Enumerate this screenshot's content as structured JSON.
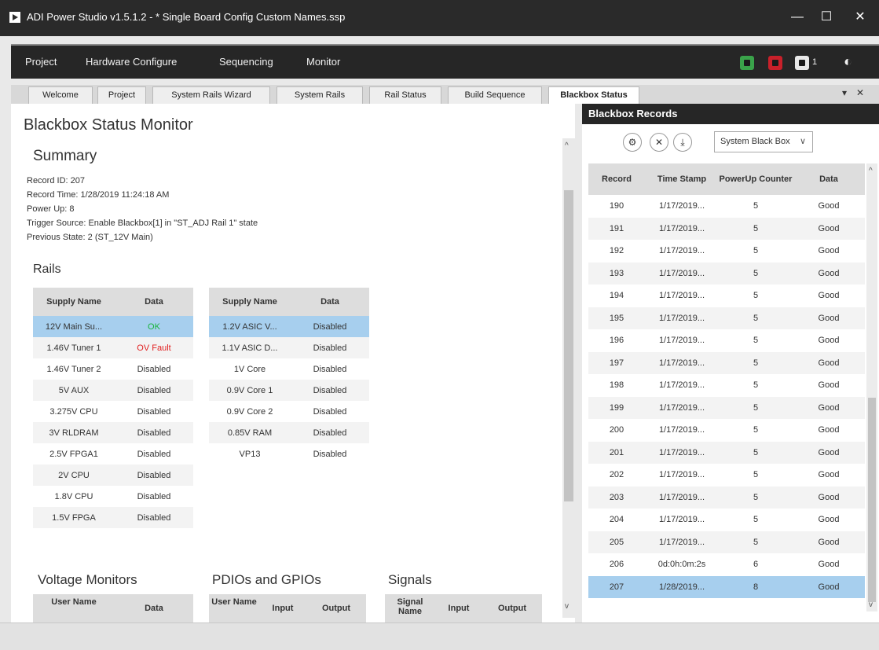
{
  "window": {
    "title": "ADI Power Studio v1.5.1.2 - * Single Board Config Custom Names.ssp",
    "minimize": "—",
    "maximize": "☐",
    "close": "✕"
  },
  "menu": {
    "items": [
      "Project",
      "Hardware Configure",
      "Sequencing",
      "Monitor"
    ],
    "device_count": "1"
  },
  "tabs": {
    "items": [
      "Welcome",
      "Project",
      "System Rails Wizard",
      "System Rails",
      "Rail Status",
      "Build Sequence",
      "Blackbox Status"
    ],
    "active": "Blackbox Status",
    "dropdown": "▾",
    "close": "✕"
  },
  "monitor": {
    "title": "Blackbox Status Monitor",
    "summary_heading": "Summary",
    "record_id": "Record ID: 207",
    "record_time": "Record Time: 1/28/2019 11:24:18 AM",
    "power_up": "Power Up: 8",
    "trigger_source": "Trigger Source: Enable Blackbox[1] in \"ST_ADJ Rail 1\" state",
    "previous_state": "Previous State: 2 (ST_12V Main)",
    "rails_heading": "Rails",
    "col_supply_name": "Supply Name",
    "col_data": "Data",
    "rails_left": [
      {
        "name": "12V Main Su...",
        "data": "OK"
      },
      {
        "name": "1.46V Tuner 1",
        "data": "OV Fault"
      },
      {
        "name": "1.46V Tuner 2",
        "data": "Disabled"
      },
      {
        "name": "5V AUX",
        "data": "Disabled"
      },
      {
        "name": "3.275V CPU",
        "data": "Disabled"
      },
      {
        "name": "3V RLDRAM",
        "data": "Disabled"
      },
      {
        "name": "2.5V FPGA1",
        "data": "Disabled"
      },
      {
        "name": "2V CPU",
        "data": "Disabled"
      },
      {
        "name": "1.8V CPU",
        "data": "Disabled"
      },
      {
        "name": "1.5V FPGA",
        "data": "Disabled"
      }
    ],
    "rails_right": [
      {
        "name": "1.2V ASIC V...",
        "data": "Disabled"
      },
      {
        "name": "1.1V ASIC D...",
        "data": "Disabled"
      },
      {
        "name": "1V Core",
        "data": "Disabled"
      },
      {
        "name": "0.9V Core 1",
        "data": "Disabled"
      },
      {
        "name": "0.9V Core 2",
        "data": "Disabled"
      },
      {
        "name": "0.85V RAM",
        "data": "Disabled"
      },
      {
        "name": "VP13",
        "data": "Disabled"
      }
    ],
    "voltage_monitors_heading": "Voltage Monitors",
    "pdios_heading": "PDIOs and GPIOs",
    "signals_heading": "Signals",
    "col_user_name": "User Name",
    "col_input": "Input",
    "col_output": "Output",
    "col_signal_name": "Signal Name"
  },
  "records": {
    "header": "Blackbox Records",
    "selector_value": "System Black Box",
    "col_record": "Record",
    "col_time_stamp": "Time Stamp",
    "col_powerup_counter": "PowerUp Counter",
    "col_data": "Data",
    "rows": [
      {
        "record": "190",
        "time": "1/17/2019...",
        "counter": "5",
        "data": "Good"
      },
      {
        "record": "191",
        "time": "1/17/2019...",
        "counter": "5",
        "data": "Good"
      },
      {
        "record": "192",
        "time": "1/17/2019...",
        "counter": "5",
        "data": "Good"
      },
      {
        "record": "193",
        "time": "1/17/2019...",
        "counter": "5",
        "data": "Good"
      },
      {
        "record": "194",
        "time": "1/17/2019...",
        "counter": "5",
        "data": "Good"
      },
      {
        "record": "195",
        "time": "1/17/2019...",
        "counter": "5",
        "data": "Good"
      },
      {
        "record": "196",
        "time": "1/17/2019...",
        "counter": "5",
        "data": "Good"
      },
      {
        "record": "197",
        "time": "1/17/2019...",
        "counter": "5",
        "data": "Good"
      },
      {
        "record": "198",
        "time": "1/17/2019...",
        "counter": "5",
        "data": "Good"
      },
      {
        "record": "199",
        "time": "1/17/2019...",
        "counter": "5",
        "data": "Good"
      },
      {
        "record": "200",
        "time": "1/17/2019...",
        "counter": "5",
        "data": "Good"
      },
      {
        "record": "201",
        "time": "1/17/2019...",
        "counter": "5",
        "data": "Good"
      },
      {
        "record": "202",
        "time": "1/17/2019...",
        "counter": "5",
        "data": "Good"
      },
      {
        "record": "203",
        "time": "1/17/2019...",
        "counter": "5",
        "data": "Good"
      },
      {
        "record": "204",
        "time": "1/17/2019...",
        "counter": "5",
        "data": "Good"
      },
      {
        "record": "205",
        "time": "1/17/2019...",
        "counter": "5",
        "data": "Good"
      },
      {
        "record": "206",
        "time": "0d:0h:0m:2s",
        "counter": "6",
        "data": "Good"
      },
      {
        "record": "207",
        "time": "1/28/2019...",
        "counter": "8",
        "data": "Good"
      }
    ],
    "selected_record": "207"
  },
  "colors": {
    "selection": "#a7cfee",
    "ok": "#19b43c",
    "fault": "#e12020",
    "chip_green": "#3aa34a",
    "chip_red": "#c8202a",
    "chip_white": "#e8e8e8"
  }
}
